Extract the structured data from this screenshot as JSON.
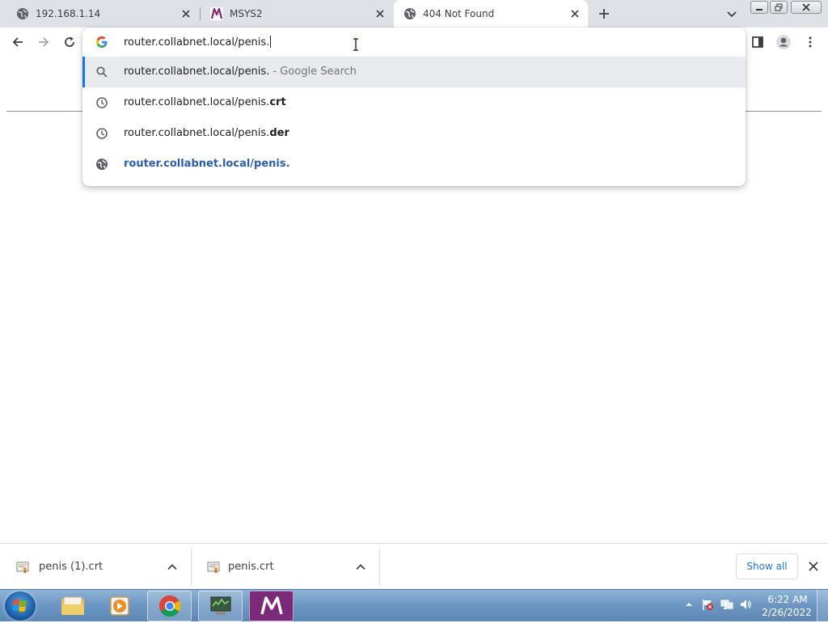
{
  "browser": {
    "tabs": [
      {
        "title": "192.168.1.14",
        "icon": "globe-icon",
        "active": false
      },
      {
        "title": "MSYS2",
        "icon": "msys2-logo-icon",
        "active": false
      },
      {
        "title": "404 Not Found",
        "icon": "globe-icon",
        "active": true
      }
    ],
    "omnibox": {
      "value": "router.collabnet.local/penis.",
      "suggestions": [
        {
          "icon": "search-icon",
          "text": "router.collabnet.local/penis.",
          "suffix": " - Google Search",
          "selected": true
        },
        {
          "icon": "history-icon",
          "text": "router.collabnet.local/penis.",
          "bold": "crt",
          "selected": false
        },
        {
          "icon": "history-icon",
          "text": "router.collabnet.local/penis.",
          "bold": "der",
          "selected": false
        },
        {
          "icon": "globe-icon",
          "text": "router.collabnet.local/penis.",
          "selected": false
        }
      ]
    }
  },
  "downloads": {
    "items": [
      {
        "name": "penis (1).crt",
        "icon": "certificate-file-icon"
      },
      {
        "name": "penis.crt",
        "icon": "certificate-file-icon"
      }
    ],
    "show_all_label": "Show all"
  },
  "taskbar": {
    "apps": [
      "windows-explorer",
      "media-player",
      "google-chrome",
      "network-tool",
      "msys2"
    ],
    "clock": {
      "time": "6:22 AM",
      "date": "2/26/2022"
    }
  },
  "colors": {
    "accent": "#1a73e8",
    "link": "#2a5db0",
    "tabstrip": "#dee1e6",
    "selected_row": "#e8eaed"
  }
}
